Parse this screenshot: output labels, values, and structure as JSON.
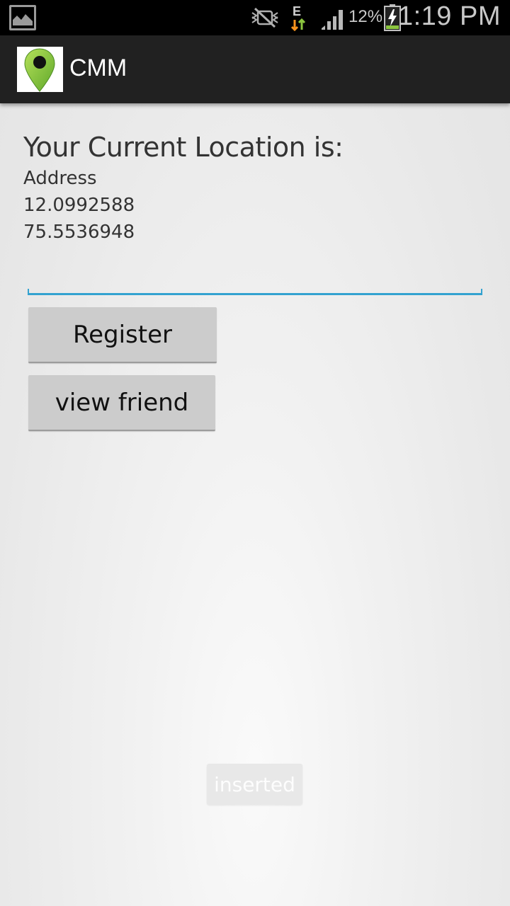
{
  "status_bar": {
    "icons": [
      "gallery-icon",
      "mute-icon",
      "network-e-icon",
      "signal-icon",
      "battery-charging-icon"
    ],
    "network_type": "E",
    "battery_percent": "12%",
    "time": "1:19 PM"
  },
  "action_bar": {
    "icon": "map-pin-icon",
    "title": "CMM"
  },
  "main": {
    "heading": "Your Current Location is:",
    "address_label": "Address",
    "latitude": "12.0992588",
    "longitude": "75.5536948",
    "name_input": {
      "value": "",
      "placeholder": ""
    },
    "register_label": "Register",
    "view_friend_label": "view friend"
  },
  "toast": {
    "text": "inserted"
  },
  "colors": {
    "accent": "#33a2d0",
    "action_bar_bg": "#212121",
    "pin_green": "#8cc63f",
    "button_bg": "#cccccc"
  }
}
